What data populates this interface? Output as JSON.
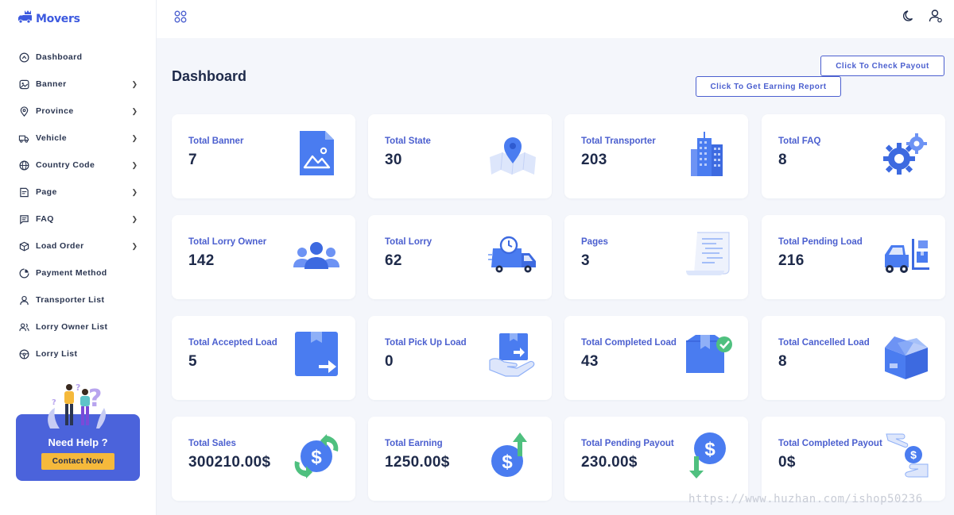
{
  "brand": {
    "name": "Movers",
    "logo_icon": "truck-crown-logo"
  },
  "sidebar": {
    "items": [
      {
        "label": "Dashboard",
        "icon": "home-icon",
        "chevron": false
      },
      {
        "label": "Banner",
        "icon": "image-icon",
        "chevron": true
      },
      {
        "label": "Province",
        "icon": "map-pin-icon",
        "chevron": true
      },
      {
        "label": "Vehicle",
        "icon": "truck-icon",
        "chevron": true
      },
      {
        "label": "Country Code",
        "icon": "globe-icon",
        "chevron": true
      },
      {
        "label": "Page",
        "icon": "page-icon",
        "chevron": true
      },
      {
        "label": "FAQ",
        "icon": "chat-icon",
        "chevron": true
      },
      {
        "label": "Load Order",
        "icon": "box-icon",
        "chevron": true
      },
      {
        "label": "Payment Method",
        "icon": "payment-icon",
        "chevron": false
      },
      {
        "label": "Transporter List",
        "icon": "user-icon",
        "chevron": false
      },
      {
        "label": "Lorry Owner List",
        "icon": "users-icon",
        "chevron": false
      },
      {
        "label": "Lorry List",
        "icon": "steering-wheel-icon",
        "chevron": false
      }
    ],
    "help": {
      "title": "Need Help ?",
      "button": "Contact Now"
    }
  },
  "topbar": {
    "grid_icon": "apps-grid-icon",
    "theme_icon": "moon-icon",
    "profile_icon": "user-profile-icon"
  },
  "main": {
    "title": "Dashboard",
    "buttons": {
      "payout": "Click To Check Payout",
      "earning": "Click To Get Earning Report"
    },
    "cards": [
      {
        "label": "Total Banner",
        "value": "7",
        "icon": "image-file-icon"
      },
      {
        "label": "Total State",
        "value": "30",
        "icon": "map-location-icon"
      },
      {
        "label": "Total Transporter",
        "value": "203",
        "icon": "building-icon"
      },
      {
        "label": "Total FAQ",
        "value": "8",
        "icon": "gears-icon"
      },
      {
        "label": "Total Lorry Owner",
        "value": "142",
        "icon": "people-group-icon"
      },
      {
        "label": "Total Lorry",
        "value": "62",
        "icon": "delivery-truck-clock-icon"
      },
      {
        "label": "Pages",
        "value": "3",
        "icon": "document-pages-icon"
      },
      {
        "label": "Total Pending Load",
        "value": "216",
        "icon": "forklift-icon"
      },
      {
        "label": "Total Accepted Load",
        "value": "5",
        "icon": "box-arrow-icon"
      },
      {
        "label": "Total Pick Up Load",
        "value": "0",
        "icon": "hand-box-icon"
      },
      {
        "label": "Total Completed Load",
        "value": "43",
        "icon": "box-check-icon"
      },
      {
        "label": "Total Cancelled Load",
        "value": "8",
        "icon": "open-box-icon"
      },
      {
        "label": "Total Sales",
        "value": "300210.00$",
        "icon": "dollar-exchange-icon"
      },
      {
        "label": "Total Earning",
        "value": "1250.00$",
        "icon": "dollar-up-icon"
      },
      {
        "label": "Total Pending Payout",
        "value": "230.00$",
        "icon": "dollar-down-icon"
      },
      {
        "label": "Total Completed Payout",
        "value": "0$",
        "icon": "hand-dollar-icon"
      }
    ]
  },
  "watermark": "https://www.huzhan.com/ishop50236",
  "colors": {
    "accent": "#4b5fcf",
    "icon_blue": "#4a7cf0",
    "help_bg": "#4b63db",
    "help_button": "#f5b93b",
    "green": "#4fc07f"
  }
}
